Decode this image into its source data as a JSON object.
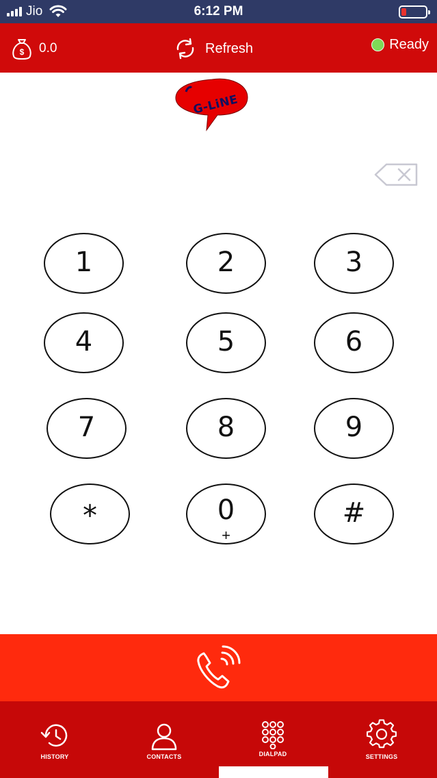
{
  "status_bar": {
    "carrier": "Jio",
    "time": "6:12 PM",
    "battery_level": 0.2,
    "battery_color": "#e8322e"
  },
  "header": {
    "balance": "0.0",
    "refresh_label": "Refresh",
    "status_label": "Ready",
    "status_color": "#7ed957",
    "background": "#d00a0a"
  },
  "logo": {
    "text": "G-LiNE",
    "color": "#e60000"
  },
  "keypad": {
    "keys": [
      {
        "digit": "1",
        "sub": ""
      },
      {
        "digit": "2",
        "sub": ""
      },
      {
        "digit": "3",
        "sub": ""
      },
      {
        "digit": "4",
        "sub": ""
      },
      {
        "digit": "5",
        "sub": ""
      },
      {
        "digit": "6",
        "sub": ""
      },
      {
        "digit": "7",
        "sub": ""
      },
      {
        "digit": "8",
        "sub": ""
      },
      {
        "digit": "9",
        "sub": ""
      },
      {
        "digit": "*",
        "sub": ""
      },
      {
        "digit": "0",
        "sub": "+"
      },
      {
        "digit": "#",
        "sub": ""
      }
    ]
  },
  "call_button": {
    "icon": "phone-ringing-icon",
    "color": "#ff2a0d"
  },
  "bottom_nav": {
    "items": [
      {
        "label": "HISTORY",
        "icon": "history-icon"
      },
      {
        "label": "CONTACTS",
        "icon": "contacts-icon"
      },
      {
        "label": "DIALPAD",
        "icon": "dialpad-icon"
      },
      {
        "label": "SETTINGS",
        "icon": "gear-icon"
      }
    ],
    "active": "DIALPAD"
  }
}
